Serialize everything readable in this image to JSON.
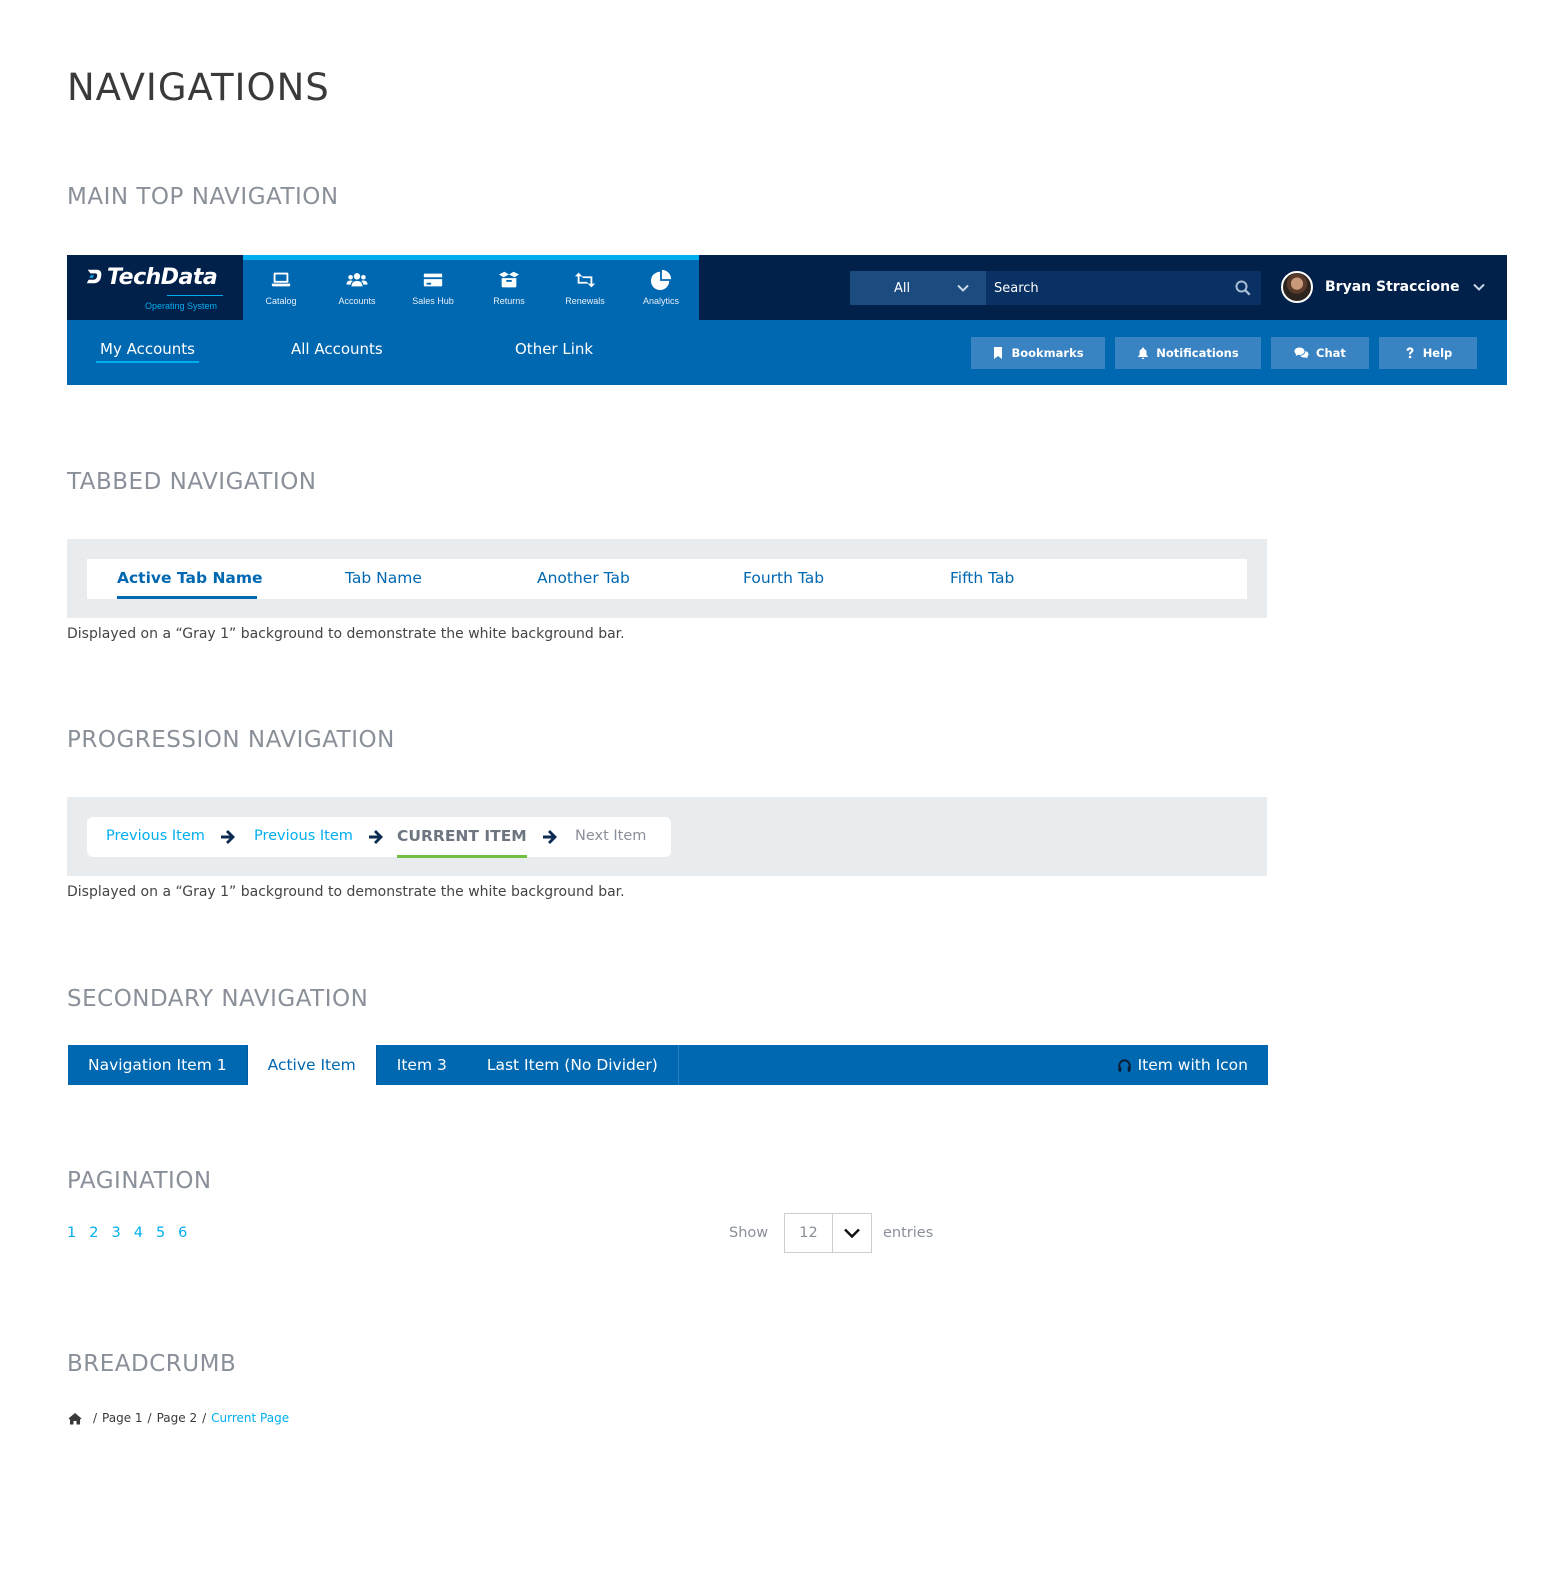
{
  "page_title": "NAVIGATIONS",
  "sections": {
    "main_top": "MAIN TOP NAVIGATION",
    "tabbed": "TABBED NAVIGATION",
    "progression": "PROGRESSION NAVIGATION",
    "secondary": "SECONDARY NAVIGATION",
    "pagination": "PAGINATION",
    "breadcrumb": "BREADCRUMB"
  },
  "topnav": {
    "logo": {
      "brand": "TechData",
      "sub": "Operating System"
    },
    "icon_items": [
      {
        "label": "Catalog",
        "icon": "laptop-icon"
      },
      {
        "label": "Accounts",
        "icon": "users-icon"
      },
      {
        "label": "Sales Hub",
        "icon": "credit-card-icon"
      },
      {
        "label": "Returns",
        "icon": "open-box-icon"
      },
      {
        "label": "Renewals",
        "icon": "retweet-icon"
      },
      {
        "label": "Analytics",
        "icon": "pie-chart-icon"
      }
    ],
    "search": {
      "scope": "All",
      "placeholder": "Search"
    },
    "user": {
      "name": "Bryan Straccione"
    },
    "sub_links": [
      "My Accounts",
      "All Accounts",
      "Other Link"
    ],
    "quick_buttons": [
      {
        "label": "Bookmarks",
        "icon": "bookmark-icon"
      },
      {
        "label": "Notifications",
        "icon": "bell-icon"
      },
      {
        "label": "Chat",
        "icon": "chat-icon"
      },
      {
        "label": "Help",
        "icon": "question-icon"
      }
    ],
    "colors": {
      "dark": "#02214a",
      "primary": "#0067b1",
      "accent": "#00aeef"
    }
  },
  "tabs": {
    "items": [
      "Active Tab Name",
      "Tab Name",
      "Another Tab",
      "Fourth Tab",
      "Fifth Tab"
    ],
    "active_index": 0,
    "caption": "Displayed on a “Gray 1” background to demonstrate the white background bar."
  },
  "progression": {
    "steps": [
      {
        "label": "Previous Item",
        "state": "done"
      },
      {
        "label": "Previous Item",
        "state": "done"
      },
      {
        "label": "CURRENT ITEM",
        "state": "current"
      },
      {
        "label": "Next Item",
        "state": "upcoming"
      }
    ],
    "caption": "Displayed on a “Gray 1” background to demonstrate the white background bar.",
    "colors": {
      "current_underline": "#72bf44"
    }
  },
  "secondary": {
    "items": [
      "Navigation Item 1",
      "Active Item",
      "Item 3",
      "Last Item (No Divider)"
    ],
    "active_index": 1,
    "icon_item": {
      "label": "Item with Icon",
      "icon": "headphones-icon"
    }
  },
  "pagination": {
    "pages": [
      "1",
      "2",
      "3",
      "4",
      "5",
      "6"
    ],
    "show_label": "Show",
    "page_size": "12",
    "entries_label": "entries"
  },
  "breadcrumb": {
    "home_icon": "home-icon",
    "items": [
      "Page 1",
      "Page 2"
    ],
    "current": "Current Page",
    "separator": "/"
  }
}
